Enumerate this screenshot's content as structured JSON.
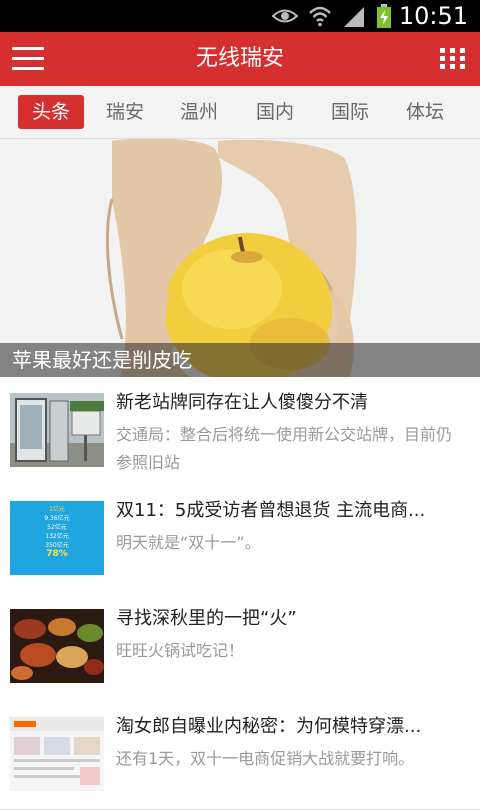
{
  "status_bar": {
    "time": "10:51",
    "icons": [
      "eye-icon",
      "wifi-icon",
      "signal-icon",
      "battery-charging-icon"
    ]
  },
  "app_bar": {
    "title": "无线瑞安",
    "left_icon": "menu-icon",
    "right_icon": "grid-icon",
    "accent_color": "#d52f30"
  },
  "tabs": [
    {
      "label": "头条",
      "active": true
    },
    {
      "label": "瑞安",
      "active": false
    },
    {
      "label": "温州",
      "active": false
    },
    {
      "label": "国内",
      "active": false
    },
    {
      "label": "国际",
      "active": false
    },
    {
      "label": "体坛",
      "active": false
    }
  ],
  "hero": {
    "caption": "苹果最好还是削皮吃"
  },
  "news": [
    {
      "title": "新老站牌同存在让人傻傻分不清",
      "summary": "交通局：整合后将统一使用新公交站牌，目前仍参照旧站",
      "thumb": "bus-stop-sign"
    },
    {
      "title": "双11：5成受访者曾想退货 主流电商...",
      "summary": "明天就是“双十一”。",
      "thumb": "sales-infographic"
    },
    {
      "title": "寻找深秋里的一把“火”",
      "summary": "旺旺火锅试吃记！",
      "thumb": "hotpot-dishes"
    },
    {
      "title": "淘女郎自曝业内秘密：为何模特穿漂...",
      "summary": "还有1天，双十一电商促销大战就要打响。",
      "thumb": "taobao-screenshot"
    }
  ],
  "thumb_text": {
    "infographic": [
      "1亿元",
      "9.36亿元",
      "52亿元",
      "132亿元",
      "350亿元",
      "78%"
    ]
  }
}
